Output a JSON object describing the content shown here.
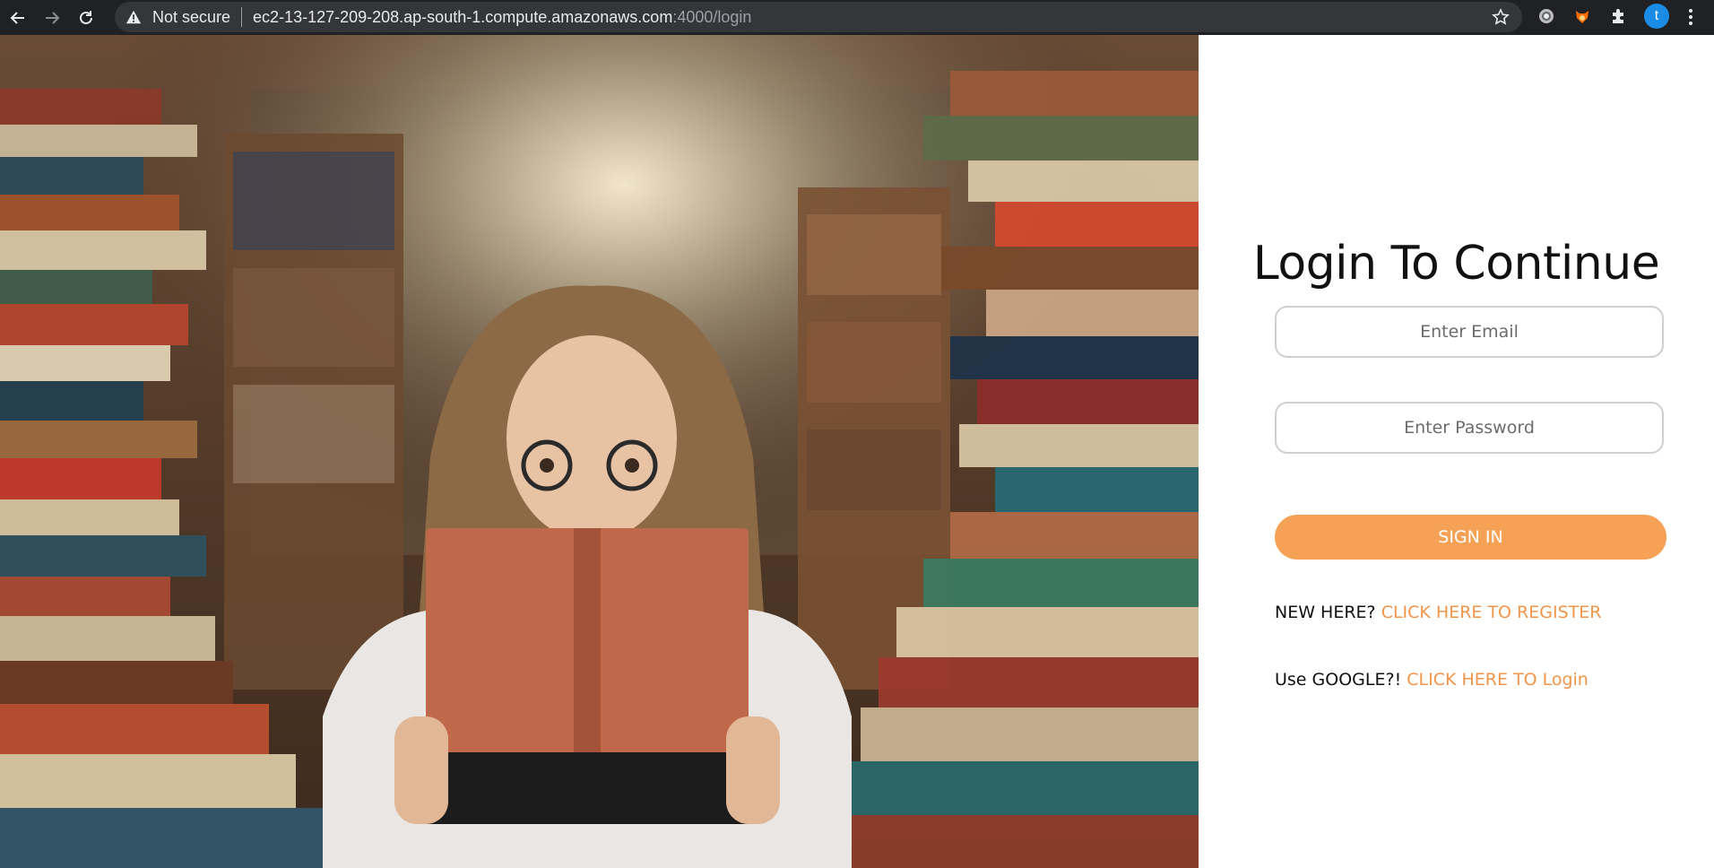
{
  "browser": {
    "security_label": "Not secure",
    "url_main": "ec2-13-127-209-208.ap-south-1.compute.amazonaws.com",
    "url_rest": ":4000/login",
    "profile_initial": "t",
    "icons": {
      "back": "back-arrow-icon",
      "forward": "forward-arrow-icon",
      "reload": "reload-icon",
      "warning": "warning-triangle-icon",
      "star": "bookmark-star-icon",
      "ext1": "circle-extension-icon",
      "ext2": "fox-extension-icon",
      "ext3": "puzzle-extensions-icon",
      "menu": "kebab-menu-icon"
    }
  },
  "hero": {
    "description_icon": "reader-with-books-photo"
  },
  "login": {
    "title": "Login To Continue",
    "email_placeholder": "Enter Email",
    "password_placeholder": "Enter Password",
    "signin_label": "SIGN IN",
    "register_prefix": "NEW HERE?",
    "register_link": "CLICK HERE TO REGISTER",
    "google_prefix": "Use GOOGLE?!",
    "google_link": "CLICK HERE TO Login"
  },
  "colors": {
    "accent": "#f5a257",
    "link": "#f0954a",
    "chrome_bg": "#202124",
    "omnibox_bg": "#35363a"
  }
}
